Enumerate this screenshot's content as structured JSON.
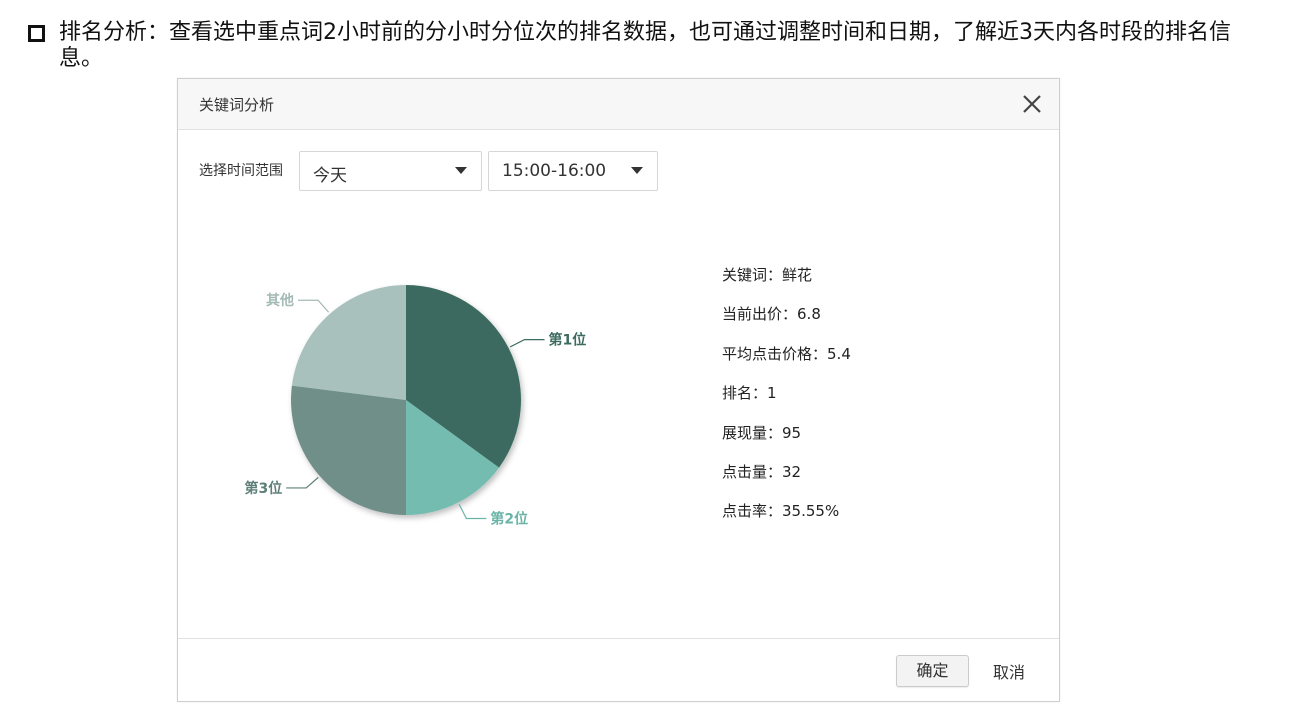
{
  "intro": {
    "text": "排名分析：查看选中重点词2小时前的分小时分位次的排名数据，也可通过调整时间和日期，了解近3天内各时段的排名信息。"
  },
  "dialog": {
    "title": "关键词分析",
    "filter": {
      "label": "选择时间范围",
      "date_value": "今天",
      "hour_value": "15:00-16:00"
    },
    "info": [
      {
        "label": "关键词：",
        "value": "鲜花"
      },
      {
        "label": "当前出价：",
        "value": "6.8"
      },
      {
        "label": "平均点击价格：",
        "value": "5.4"
      },
      {
        "label": "排名：",
        "value": "1"
      },
      {
        "label": "展现量：",
        "value": "95"
      },
      {
        "label": "点击量：",
        "value": "32"
      },
      {
        "label": "点击率：",
        "value": "35.55%"
      }
    ],
    "buttons": {
      "ok": "确定",
      "cancel": "取消"
    }
  },
  "chart_data": {
    "type": "pie",
    "slices": [
      {
        "label": "第1位",
        "value": 35,
        "color": "#3d6b60"
      },
      {
        "label": "第2位",
        "value": 15,
        "color": "#74bcb0"
      },
      {
        "label": "第3位",
        "value": 27,
        "color": "#718f89"
      },
      {
        "label": "其他",
        "value": 23,
        "color": "#a9c1bc"
      }
    ]
  },
  "colors": {
    "label_1": "#3d6b60",
    "label_2": "#6ab4a7",
    "label_3": "#5f7f79",
    "label_other": "#a3bab5"
  }
}
